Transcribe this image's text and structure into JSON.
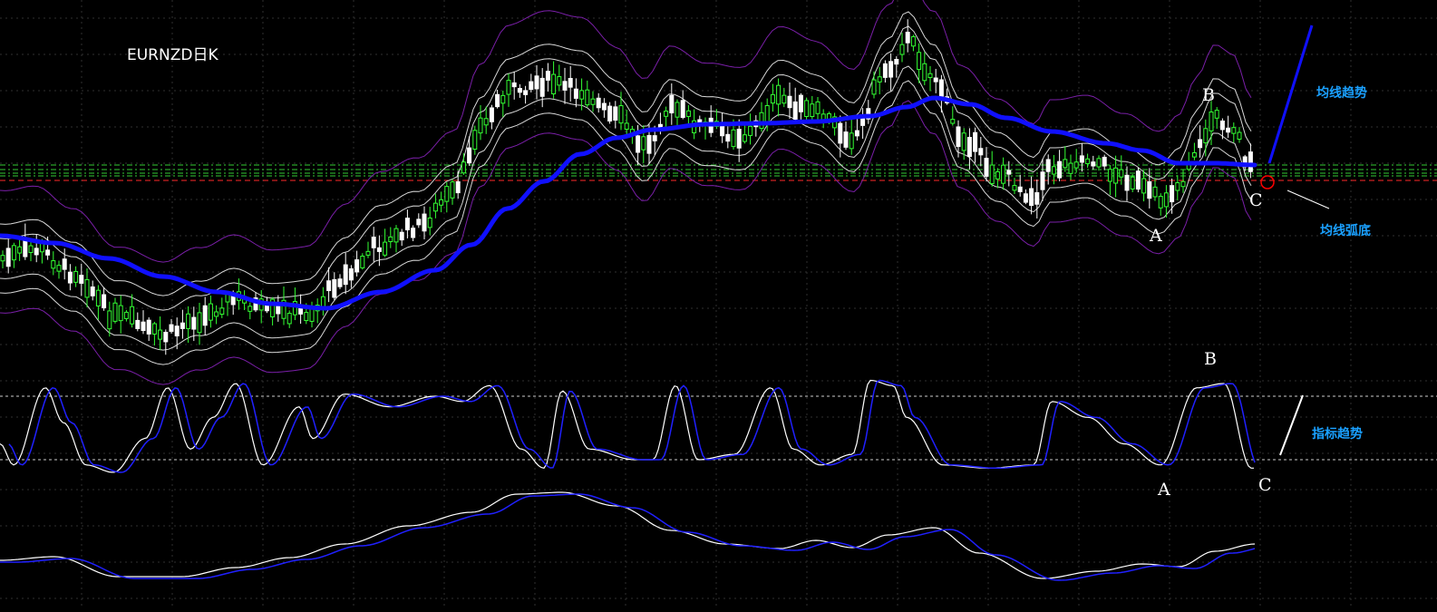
{
  "chart_data": [
    {
      "type": "candlestick",
      "title": "EURNZD日K",
      "grid": true,
      "y_direction": "price",
      "overlays": [
        "moving-average",
        "envelope-bands",
        "horizontal-levels"
      ],
      "moving_average_color": "#1010ff",
      "bull_candle_color": "#33ff33",
      "bear_candle_color": "#ffffff",
      "point_labels": [
        "A",
        "B",
        "C"
      ],
      "annotations": [
        {
          "text": "均线趋势"
        },
        {
          "text": "均线弧底"
        }
      ],
      "highlight_color": "#ff0000"
    },
    {
      "type": "line",
      "indicator": "oscillator",
      "series_colors": [
        "#ffffff",
        "#2020ff"
      ],
      "overbought_level": 80,
      "oversold_level": 20,
      "point_labels": [
        "A",
        "B",
        "C"
      ],
      "annotations": [
        {
          "text": "指标趋势"
        }
      ]
    },
    {
      "type": "line",
      "indicator": "moving-average-oscillator",
      "series_colors": [
        "#ffffff",
        "#2020ff"
      ]
    }
  ],
  "colors": {
    "background": "#000000",
    "grid": "#303030",
    "level_green": "#33cc33",
    "level_red": "#ff2a2a",
    "trend_blue": "#1010ff",
    "note_blue": "#1aa0ff"
  }
}
